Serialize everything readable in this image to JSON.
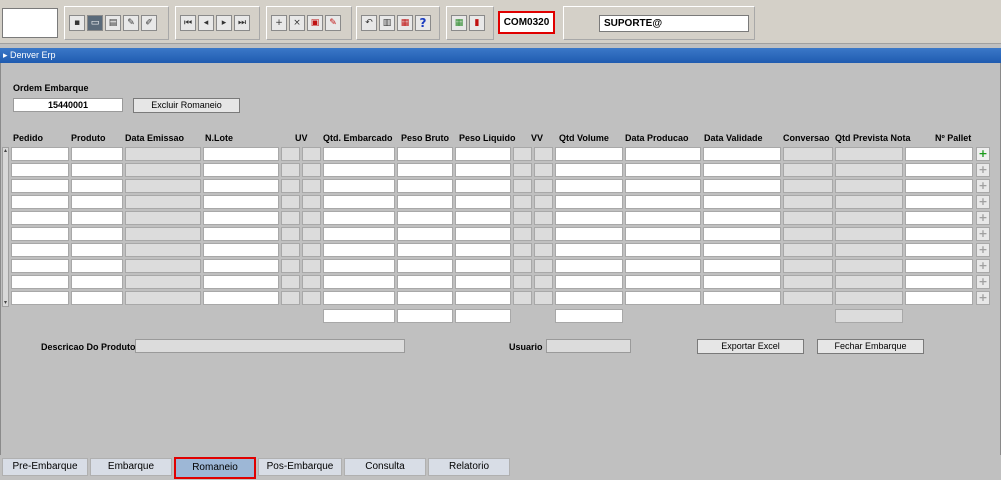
{
  "toolbar": {
    "form_code": "COM0320",
    "user": "SUPORTE@",
    "buttons_group1": [
      "save-icon",
      "window-icon",
      "print-icon",
      "key-icon",
      "pencil-icon"
    ],
    "buttons_group2": [
      "first-record-icon",
      "previous-record-icon",
      "next-record-icon",
      "last-record-icon"
    ],
    "buttons_group3": [
      "insert-record-icon",
      "delete-record-icon",
      "query-icon",
      "edit-icon"
    ],
    "buttons_group4": [
      "undo-icon",
      "clipboard-icon",
      "folder-icon",
      "help-icon"
    ],
    "help_glyph": "?",
    "buttons_group5": [
      "calculator-icon",
      "exit-icon"
    ]
  },
  "titlebar": {
    "title": "Denver Erp"
  },
  "header": {
    "ordem_label": "Ordem Embarque",
    "ordem_value": "15440001",
    "excluir_button": "Excluir Romaneio"
  },
  "grid": {
    "columns": [
      "Pedido",
      "Produto",
      "Data Emissao",
      "N.Lote",
      "UV",
      "Qtd. Embarcado",
      "Peso Bruto",
      "Peso Liquido",
      "VV",
      "Qtd Volume",
      "Data Producao",
      "Data  Validade",
      "Conversao",
      "Qtd Prevista Nota",
      "Nº Pallet"
    ],
    "row_count": 10
  },
  "footer": {
    "descricao_label": "Descricao Do Produto",
    "usuario_label": "Usuario",
    "exportar_button": "Exportar Excel",
    "fechar_button": "Fechar Embarque"
  },
  "tabs": [
    {
      "label": "Pre-Embarque",
      "active": false
    },
    {
      "label": "Embarque",
      "active": false
    },
    {
      "label": "Romaneio",
      "active": true
    },
    {
      "label": "Pos-Embarque",
      "active": false
    },
    {
      "label": "Consulta",
      "active": false
    },
    {
      "label": "Relatorio",
      "active": false
    }
  ]
}
